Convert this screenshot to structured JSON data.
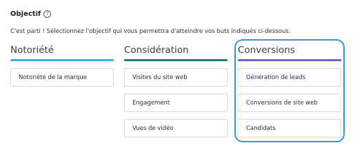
{
  "header": {
    "title": "Objectif",
    "help_icon": "?",
    "subtitle": "C'est parti ! Sélectionnez l'objectif qui vous permettra d'atteindre vos buts indiqués ci-dessous."
  },
  "colors": {
    "notoriete_bar": "#3bb4e5",
    "consideration_bar": "#1e7d78",
    "conversions_bar": "#6a5fd0",
    "selection_frame": "#2d9bd6"
  },
  "columns": [
    {
      "label": "Notoriété",
      "options": [
        "Notoriété de la marque"
      ]
    },
    {
      "label": "Considération",
      "options": [
        "Visites du site web",
        "Engagement",
        "Vues de vidéo"
      ]
    },
    {
      "label": "Conversions",
      "options": [
        "Génération de leads",
        "Conversions de site web",
        "Candidats"
      ]
    }
  ]
}
